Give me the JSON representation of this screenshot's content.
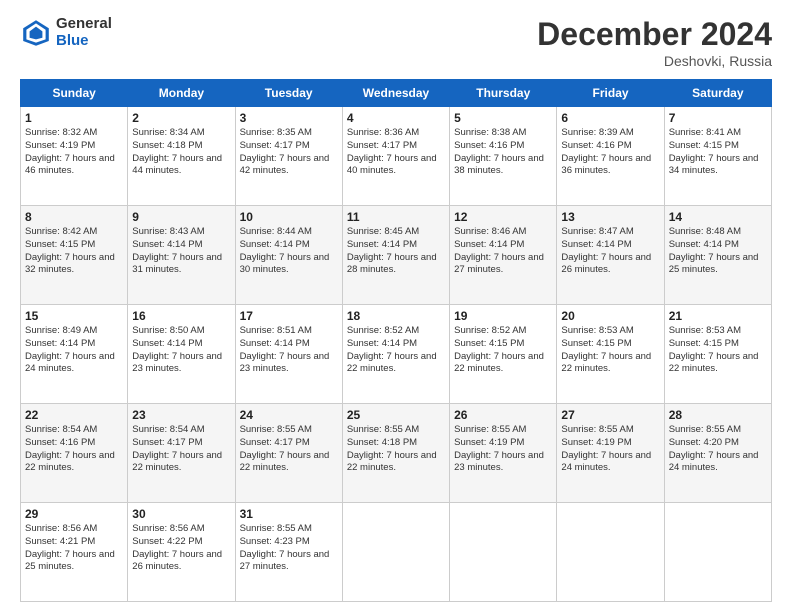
{
  "header": {
    "logo_general": "General",
    "logo_blue": "Blue",
    "month_title": "December 2024",
    "subtitle": "Deshovki, Russia"
  },
  "days_of_week": [
    "Sunday",
    "Monday",
    "Tuesday",
    "Wednesday",
    "Thursday",
    "Friday",
    "Saturday"
  ],
  "weeks": [
    [
      {
        "day": "1",
        "sunrise": "Sunrise: 8:32 AM",
        "sunset": "Sunset: 4:19 PM",
        "daylight": "Daylight: 7 hours and 46 minutes."
      },
      {
        "day": "2",
        "sunrise": "Sunrise: 8:34 AM",
        "sunset": "Sunset: 4:18 PM",
        "daylight": "Daylight: 7 hours and 44 minutes."
      },
      {
        "day": "3",
        "sunrise": "Sunrise: 8:35 AM",
        "sunset": "Sunset: 4:17 PM",
        "daylight": "Daylight: 7 hours and 42 minutes."
      },
      {
        "day": "4",
        "sunrise": "Sunrise: 8:36 AM",
        "sunset": "Sunset: 4:17 PM",
        "daylight": "Daylight: 7 hours and 40 minutes."
      },
      {
        "day": "5",
        "sunrise": "Sunrise: 8:38 AM",
        "sunset": "Sunset: 4:16 PM",
        "daylight": "Daylight: 7 hours and 38 minutes."
      },
      {
        "day": "6",
        "sunrise": "Sunrise: 8:39 AM",
        "sunset": "Sunset: 4:16 PM",
        "daylight": "Daylight: 7 hours and 36 minutes."
      },
      {
        "day": "7",
        "sunrise": "Sunrise: 8:41 AM",
        "sunset": "Sunset: 4:15 PM",
        "daylight": "Daylight: 7 hours and 34 minutes."
      }
    ],
    [
      {
        "day": "8",
        "sunrise": "Sunrise: 8:42 AM",
        "sunset": "Sunset: 4:15 PM",
        "daylight": "Daylight: 7 hours and 32 minutes."
      },
      {
        "day": "9",
        "sunrise": "Sunrise: 8:43 AM",
        "sunset": "Sunset: 4:14 PM",
        "daylight": "Daylight: 7 hours and 31 minutes."
      },
      {
        "day": "10",
        "sunrise": "Sunrise: 8:44 AM",
        "sunset": "Sunset: 4:14 PM",
        "daylight": "Daylight: 7 hours and 30 minutes."
      },
      {
        "day": "11",
        "sunrise": "Sunrise: 8:45 AM",
        "sunset": "Sunset: 4:14 PM",
        "daylight": "Daylight: 7 hours and 28 minutes."
      },
      {
        "day": "12",
        "sunrise": "Sunrise: 8:46 AM",
        "sunset": "Sunset: 4:14 PM",
        "daylight": "Daylight: 7 hours and 27 minutes."
      },
      {
        "day": "13",
        "sunrise": "Sunrise: 8:47 AM",
        "sunset": "Sunset: 4:14 PM",
        "daylight": "Daylight: 7 hours and 26 minutes."
      },
      {
        "day": "14",
        "sunrise": "Sunrise: 8:48 AM",
        "sunset": "Sunset: 4:14 PM",
        "daylight": "Daylight: 7 hours and 25 minutes."
      }
    ],
    [
      {
        "day": "15",
        "sunrise": "Sunrise: 8:49 AM",
        "sunset": "Sunset: 4:14 PM",
        "daylight": "Daylight: 7 hours and 24 minutes."
      },
      {
        "day": "16",
        "sunrise": "Sunrise: 8:50 AM",
        "sunset": "Sunset: 4:14 PM",
        "daylight": "Daylight: 7 hours and 23 minutes."
      },
      {
        "day": "17",
        "sunrise": "Sunrise: 8:51 AM",
        "sunset": "Sunset: 4:14 PM",
        "daylight": "Daylight: 7 hours and 23 minutes."
      },
      {
        "day": "18",
        "sunrise": "Sunrise: 8:52 AM",
        "sunset": "Sunset: 4:14 PM",
        "daylight": "Daylight: 7 hours and 22 minutes."
      },
      {
        "day": "19",
        "sunrise": "Sunrise: 8:52 AM",
        "sunset": "Sunset: 4:15 PM",
        "daylight": "Daylight: 7 hours and 22 minutes."
      },
      {
        "day": "20",
        "sunrise": "Sunrise: 8:53 AM",
        "sunset": "Sunset: 4:15 PM",
        "daylight": "Daylight: 7 hours and 22 minutes."
      },
      {
        "day": "21",
        "sunrise": "Sunrise: 8:53 AM",
        "sunset": "Sunset: 4:15 PM",
        "daylight": "Daylight: 7 hours and 22 minutes."
      }
    ],
    [
      {
        "day": "22",
        "sunrise": "Sunrise: 8:54 AM",
        "sunset": "Sunset: 4:16 PM",
        "daylight": "Daylight: 7 hours and 22 minutes."
      },
      {
        "day": "23",
        "sunrise": "Sunrise: 8:54 AM",
        "sunset": "Sunset: 4:17 PM",
        "daylight": "Daylight: 7 hours and 22 minutes."
      },
      {
        "day": "24",
        "sunrise": "Sunrise: 8:55 AM",
        "sunset": "Sunset: 4:17 PM",
        "daylight": "Daylight: 7 hours and 22 minutes."
      },
      {
        "day": "25",
        "sunrise": "Sunrise: 8:55 AM",
        "sunset": "Sunset: 4:18 PM",
        "daylight": "Daylight: 7 hours and 22 minutes."
      },
      {
        "day": "26",
        "sunrise": "Sunrise: 8:55 AM",
        "sunset": "Sunset: 4:19 PM",
        "daylight": "Daylight: 7 hours and 23 minutes."
      },
      {
        "day": "27",
        "sunrise": "Sunrise: 8:55 AM",
        "sunset": "Sunset: 4:19 PM",
        "daylight": "Daylight: 7 hours and 24 minutes."
      },
      {
        "day": "28",
        "sunrise": "Sunrise: 8:55 AM",
        "sunset": "Sunset: 4:20 PM",
        "daylight": "Daylight: 7 hours and 24 minutes."
      }
    ],
    [
      {
        "day": "29",
        "sunrise": "Sunrise: 8:56 AM",
        "sunset": "Sunset: 4:21 PM",
        "daylight": "Daylight: 7 hours and 25 minutes."
      },
      {
        "day": "30",
        "sunrise": "Sunrise: 8:56 AM",
        "sunset": "Sunset: 4:22 PM",
        "daylight": "Daylight: 7 hours and 26 minutes."
      },
      {
        "day": "31",
        "sunrise": "Sunrise: 8:55 AM",
        "sunset": "Sunset: 4:23 PM",
        "daylight": "Daylight: 7 hours and 27 minutes."
      },
      null,
      null,
      null,
      null
    ]
  ]
}
